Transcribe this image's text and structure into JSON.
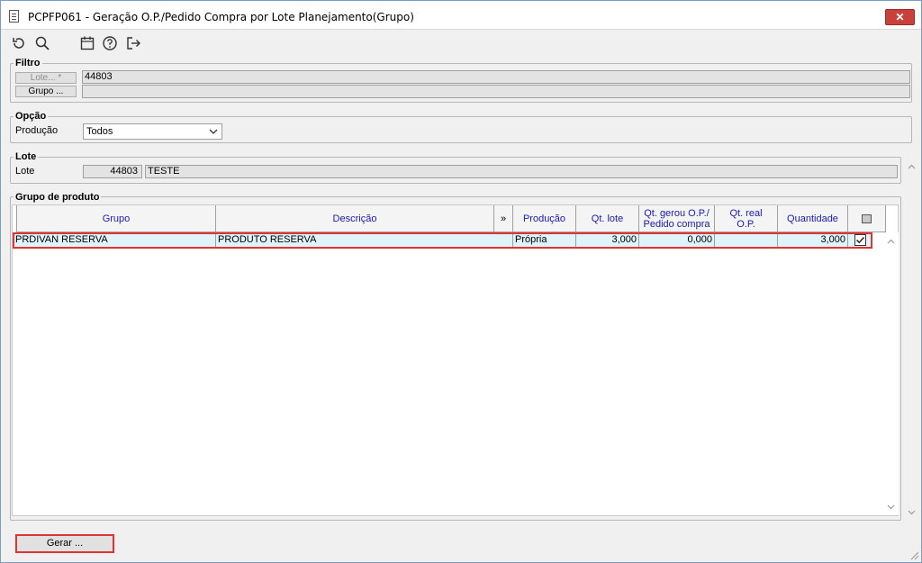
{
  "window": {
    "title": "PCPFP061 - Geração O.P./Pedido Compra por Lote Planejamento(Grupo)",
    "close_label": "✕"
  },
  "toolbar": {
    "icons": [
      "refresh-icon",
      "search-icon",
      "calendar-icon",
      "help-icon",
      "exit-icon"
    ]
  },
  "filtro": {
    "legend": "Filtro",
    "lote_button": "Lote... *",
    "lote_value": "44803",
    "grupo_button": "Grupo ...",
    "grupo_value": ""
  },
  "opcao": {
    "legend": "Opção",
    "producao_label": "Produção",
    "producao_value": "Todos"
  },
  "lote": {
    "legend": "Lote",
    "label": "Lote",
    "number": "44803",
    "description": "TESTE"
  },
  "grupo_produto": {
    "legend": "Grupo de produto",
    "columns": {
      "grupo": "Grupo",
      "descricao": "Descrição",
      "expand": "»",
      "producao": "Produção",
      "qt_lote": "Qt. lote",
      "qt_gerou_1": "Qt. gerou O.P./",
      "qt_gerou_2": "Pedido compra",
      "qt_real_1": "Qt. real",
      "qt_real_2": "O.P.",
      "quantidade": "Quantidade"
    },
    "rows": [
      {
        "grupo": "PRDIVAN RESERVA",
        "descricao": "PRODUTO RESERVA",
        "producao": "Própria",
        "qt_lote": "3,000",
        "qt_gerou": "0,000",
        "qt_real": "",
        "quantidade": "3,000",
        "checked": true
      }
    ]
  },
  "actions": {
    "gerar_label": "Gerar ..."
  },
  "colors": {
    "highlight_border": "#e03434",
    "header_text": "#1a1ab0",
    "selected_row": "#dff3fb"
  }
}
